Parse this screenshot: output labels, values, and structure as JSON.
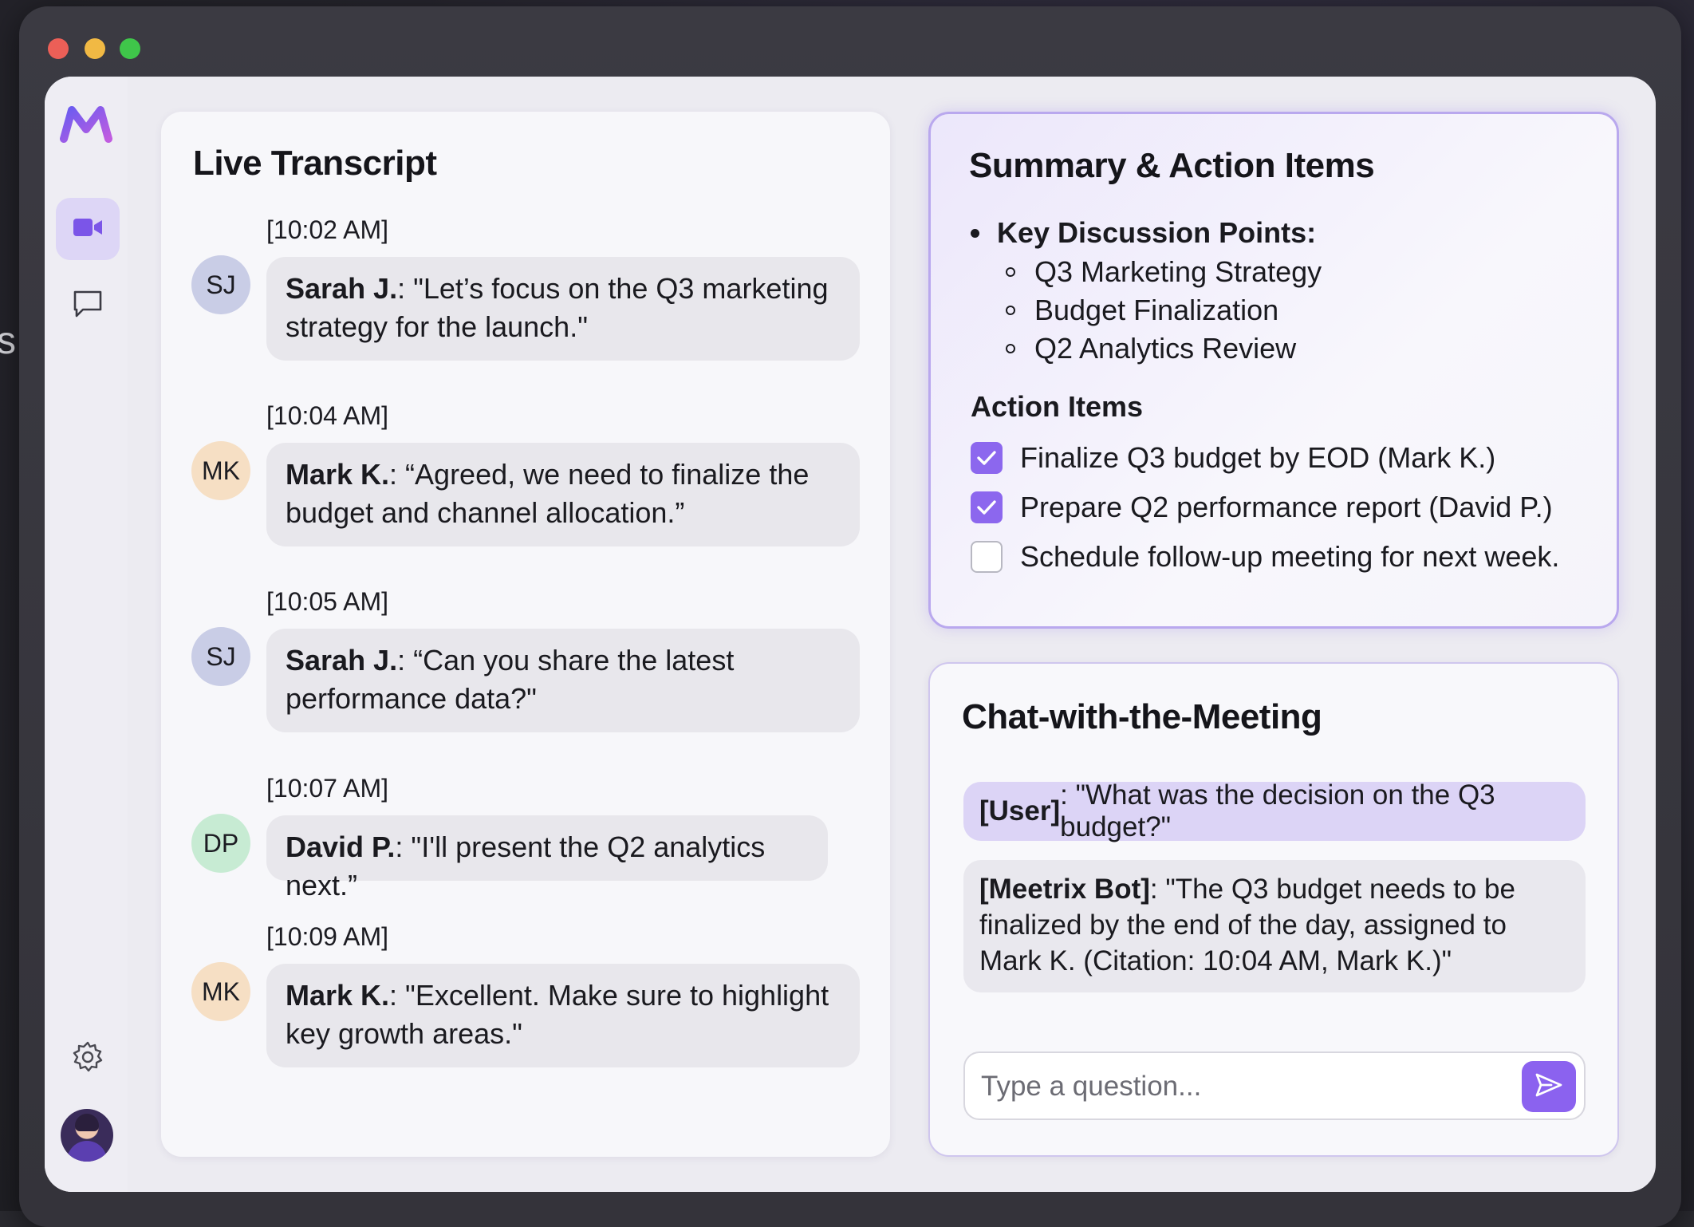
{
  "desktop": {
    "partial_text": "s."
  },
  "sidebar": {
    "logo": "meetrix-logo",
    "items": [
      {
        "icon": "video-icon",
        "active": true
      },
      {
        "icon": "chat-bubble-icon",
        "active": false
      }
    ],
    "settings_icon": "gear-icon",
    "avatar_icon": "user-avatar"
  },
  "transcript": {
    "title": "Live Transcript",
    "messages": [
      {
        "time": "[10:02 AM]",
        "initials": "SJ",
        "color": "#c9cde6",
        "speaker": "Sarah J.",
        "text": ": \"Let’s focus on the Q3 marketing strategy for the launch.\""
      },
      {
        "time": "[10:04 AM]",
        "initials": "MK",
        "color": "#f6dfc4",
        "speaker": "Mark K.",
        "text": ": “Agreed, we need to finalize the budget and channel allocation.”"
      },
      {
        "time": "[10:05 AM]",
        "initials": "SJ",
        "color": "#c9cde6",
        "speaker": "Sarah J.",
        "text": ": “Can you share the latest performance data?\""
      },
      {
        "time": "[10:07 AM]",
        "initials": "DP",
        "color": "#c7ebd3",
        "speaker": "David P.",
        "text": ": \"I'll present the Q2 analytics next.”"
      },
      {
        "time": "[10:09 AM]",
        "initials": "MK",
        "color": "#f6dfc4",
        "speaker": "Mark K.",
        "text": ": \"Excellent. Make sure to highlight key growth areas.\""
      }
    ]
  },
  "summary": {
    "title": "Summary & Action Items",
    "discussion_heading": "Key Discussion Points:",
    "discussion_points": [
      "Q3 Marketing Strategy",
      "Budget Finalization",
      "Q2 Analytics Review"
    ],
    "action_heading": "Action Items",
    "action_items": [
      {
        "label": "Finalize Q3 budget by EOD (Mark K.)",
        "checked": true
      },
      {
        "label": "Prepare Q2 performance report (David P.)",
        "checked": true
      },
      {
        "label": "Schedule follow-up meeting for next week.",
        "checked": false
      }
    ]
  },
  "chat": {
    "title": "Chat-with-the-Meeting",
    "user_speaker": "[User]",
    "user_text": ": \"What was the decision on the Q3 budget?\"",
    "bot_speaker": "[Meetrix Bot]",
    "bot_text": ": \"The Q3 budget needs to be finalized by the end of the day, assigned to Mark K. (Citation: 10:04 AM, Mark K.)\"",
    "input_value": "",
    "input_placeholder": "Type a question...",
    "send_icon": "send-icon"
  },
  "colors": {
    "accent": "#8b62ef",
    "accent_light": "#dcd4f6",
    "summary_border": "#b9a8ee"
  }
}
